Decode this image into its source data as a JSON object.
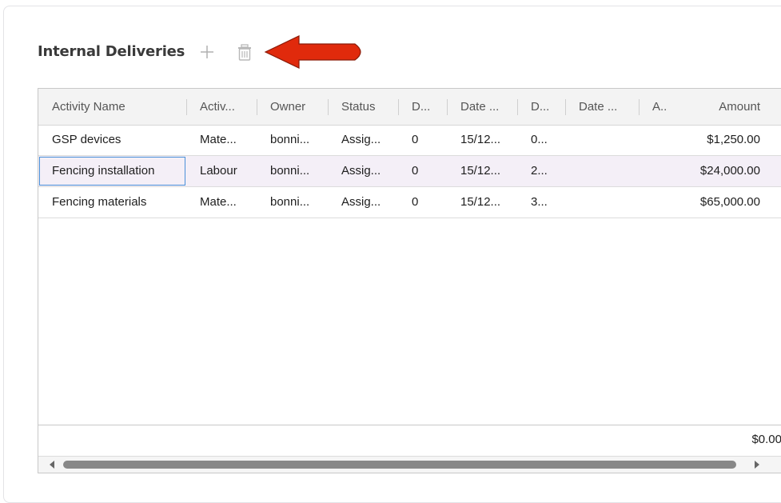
{
  "section": {
    "title": "Internal Deliveries"
  },
  "grid": {
    "columns": [
      "Activity Name",
      "Activ...",
      "Owner",
      "Status",
      "D...",
      "Date ...",
      "D...",
      "Date ...",
      "A..",
      "Amount"
    ],
    "rows": [
      [
        "GSP devices",
        "Mate...",
        "bonni...",
        "Assig...",
        "0",
        "15/12...",
        "0...",
        "",
        "",
        "$1,250.00"
      ],
      [
        "Fencing installation",
        "Labour",
        "bonni...",
        "Assig...",
        "0",
        "15/12...",
        "2...",
        "",
        "",
        "$24,000.00"
      ],
      [
        "Fencing materials",
        "Mate...",
        "bonni...",
        "Assig...",
        "0",
        "15/12...",
        "3...",
        "",
        "",
        "$65,000.00"
      ]
    ],
    "selected_row": 1,
    "footer_total": "$0.00"
  },
  "colors": {
    "arrow": "#e02a0c",
    "selection": "#f4eff7",
    "focus": "#4a90d9"
  }
}
